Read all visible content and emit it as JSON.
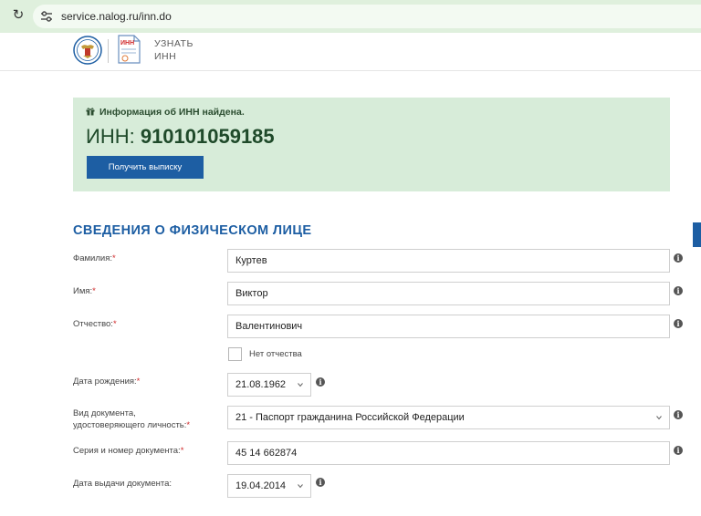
{
  "browser": {
    "url": "service.nalog.ru/inn.do"
  },
  "header": {
    "logo_line1": "УЗНАТЬ",
    "logo_line2": "ИНН",
    "doc_badge": "ИНН"
  },
  "result": {
    "found_text": "Информация об ИНН найдена.",
    "inn_label": "ИНН:",
    "inn_value": "910101059185",
    "button_label": "Получить выписку"
  },
  "section": {
    "title": "СВЕДЕНИЯ О ФИЗИЧЕСКОМ ЛИЦЕ",
    "surname": {
      "label": "Фамилия:",
      "value": "Куртев"
    },
    "name": {
      "label": "Имя:",
      "value": "Виктор"
    },
    "patronymic": {
      "label": "Отчество:",
      "value": "Валентинович"
    },
    "no_patronymic_label": "Нет отчества",
    "birth_date": {
      "label": "Дата рождения:",
      "value": "21.08.1962"
    },
    "doc_type": {
      "label_line1": "Вид документа,",
      "label_line2": "удостоверяющего личность:",
      "value": "21 - Паспорт гражданина Российской Федерации"
    },
    "doc_number": {
      "label": "Серия и номер документа:",
      "value": "45 14 662874"
    },
    "issue_date": {
      "label": "Дата выдачи документа:",
      "value": "19.04.2014"
    }
  },
  "required_mark": "*",
  "info_glyph": "i",
  "colors": {
    "accent": "#1d5ea3",
    "panel": "#d7ecd9",
    "required": "#d0292a"
  }
}
